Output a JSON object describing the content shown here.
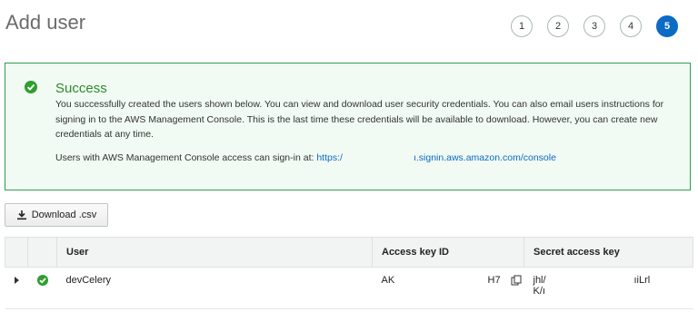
{
  "page": {
    "title": "Add user"
  },
  "steps": [
    "1",
    "2",
    "3",
    "4",
    "5"
  ],
  "alert": {
    "title": "Success",
    "body": "You successfully created the users shown below. You can view and download user security credentials. You can also email users instructions for signing in to the AWS Management Console. This is the last time these credentials will be available to download. However, you can create new credentials at any time.",
    "signin_prefix": "Users with AWS Management Console access can sign-in at:",
    "signin_link_start": "https:/",
    "signin_link_end": "ı.signin.aws.amazon.com/console"
  },
  "download_button": {
    "label": "Download .csv"
  },
  "table": {
    "headers": {
      "user": "User",
      "access_key": "Access key ID",
      "secret": "Secret access key"
    },
    "rows": [
      {
        "user": "devCelery",
        "access_key_start": "AK",
        "access_key_end": "H7",
        "secret_start": "jhl/",
        "secret_line2": "K/ı",
        "secret_end": "ıiLrl"
      }
    ]
  },
  "colors": {
    "accent": "#0b6bc5",
    "success": "#2e9e2e",
    "alert_bg": "#f1faf3"
  }
}
